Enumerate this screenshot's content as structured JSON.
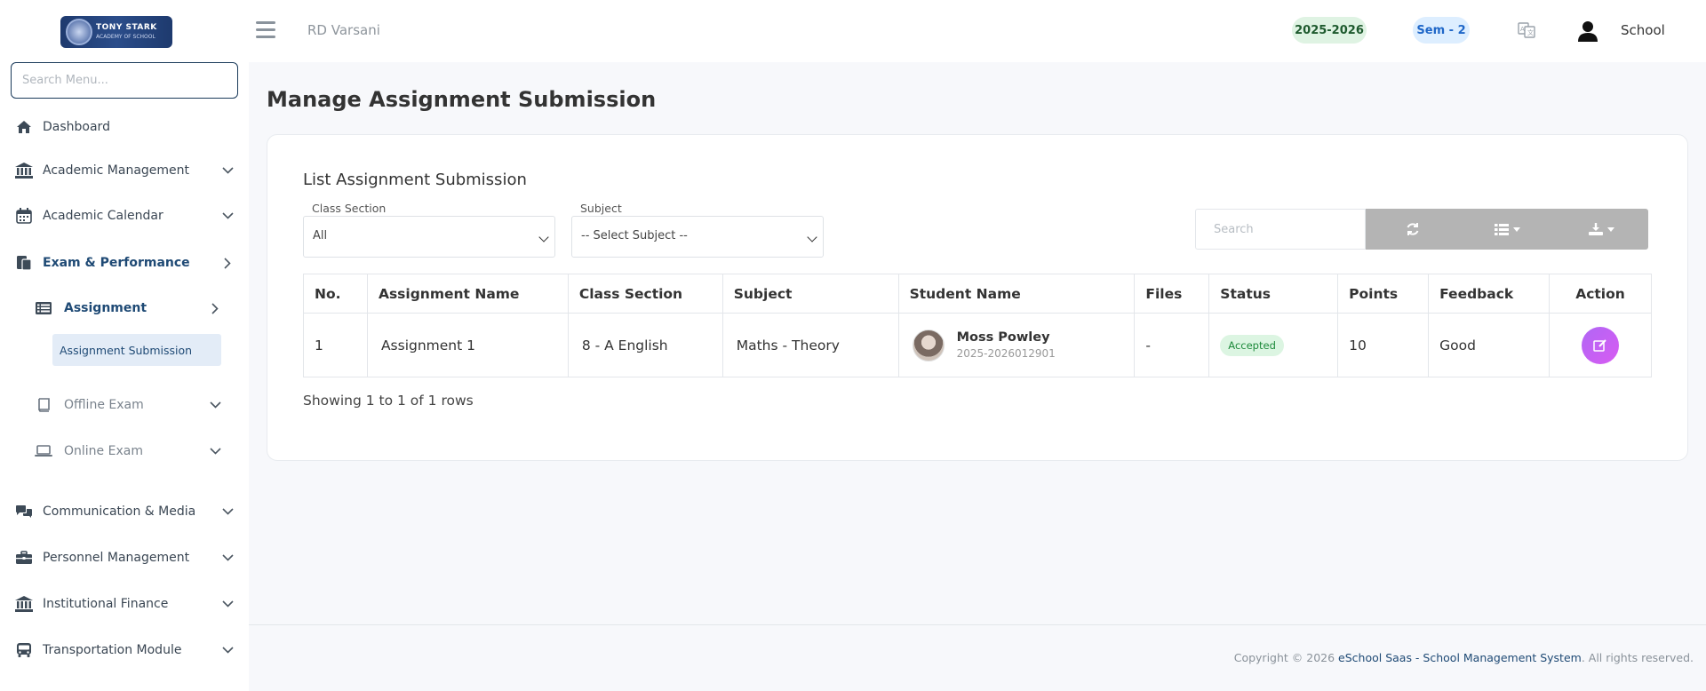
{
  "sidebar": {
    "search_placeholder": "Search Menu...",
    "items": [
      {
        "label": "Dashboard",
        "icon": "home-icon"
      },
      {
        "label": "Academic Management",
        "icon": "institution-icon"
      },
      {
        "label": "Academic Calendar",
        "icon": "calendar-icon"
      },
      {
        "label": "Exam & Performance",
        "icon": "exam-icon"
      },
      {
        "label": "Communication & Media",
        "icon": "chat-icon"
      },
      {
        "label": "Personnel Management",
        "icon": "briefcase-icon"
      },
      {
        "label": "Institutional Finance",
        "icon": "institution-icon"
      },
      {
        "label": "Transportation Module",
        "icon": "bus-icon"
      }
    ],
    "exam_sub": [
      {
        "label": "Assignment",
        "icon": "list-icon"
      },
      {
        "label": "Offline Exam",
        "icon": "book-icon"
      },
      {
        "label": "Online Exam",
        "icon": "laptop-icon"
      }
    ],
    "active_leaf": "Assignment Submission"
  },
  "topbar": {
    "school_name": "RD Varsani",
    "session": "2025-2026",
    "semester": "Sem - 2",
    "user": "School"
  },
  "page": {
    "title": "Manage Assignment Submission",
    "card_title": "List Assignment Submission"
  },
  "filters": {
    "class_section_label": "Class Section",
    "class_section_value": "All",
    "subject_label": "Subject",
    "subject_value": "-- Select Subject --",
    "search_placeholder": "Search"
  },
  "table": {
    "columns": [
      "No.",
      "Assignment Name",
      "Class Section",
      "Subject",
      "Student Name",
      "Files",
      "Status",
      "Points",
      "Feedback",
      "Action"
    ],
    "rows": [
      {
        "no": "1",
        "assignment": "Assignment 1",
        "class_section": "8 - A English",
        "subject": "Maths - Theory",
        "student_name": "Moss Powley",
        "student_id": "2025-2026012901",
        "files": "-",
        "status": "Accepted",
        "points": "10",
        "feedback": "Good"
      }
    ],
    "showing": "Showing 1 to 1 of 1 rows"
  },
  "footer": {
    "prefix": "Copyright © 2026 ",
    "brand": "eSchool Saas - School Management System",
    "suffix": ". All rights reserved."
  },
  "colors": {
    "primary": "#1f4a75",
    "accent": "#c061f4",
    "status_accepted": "#1d8a3b"
  }
}
